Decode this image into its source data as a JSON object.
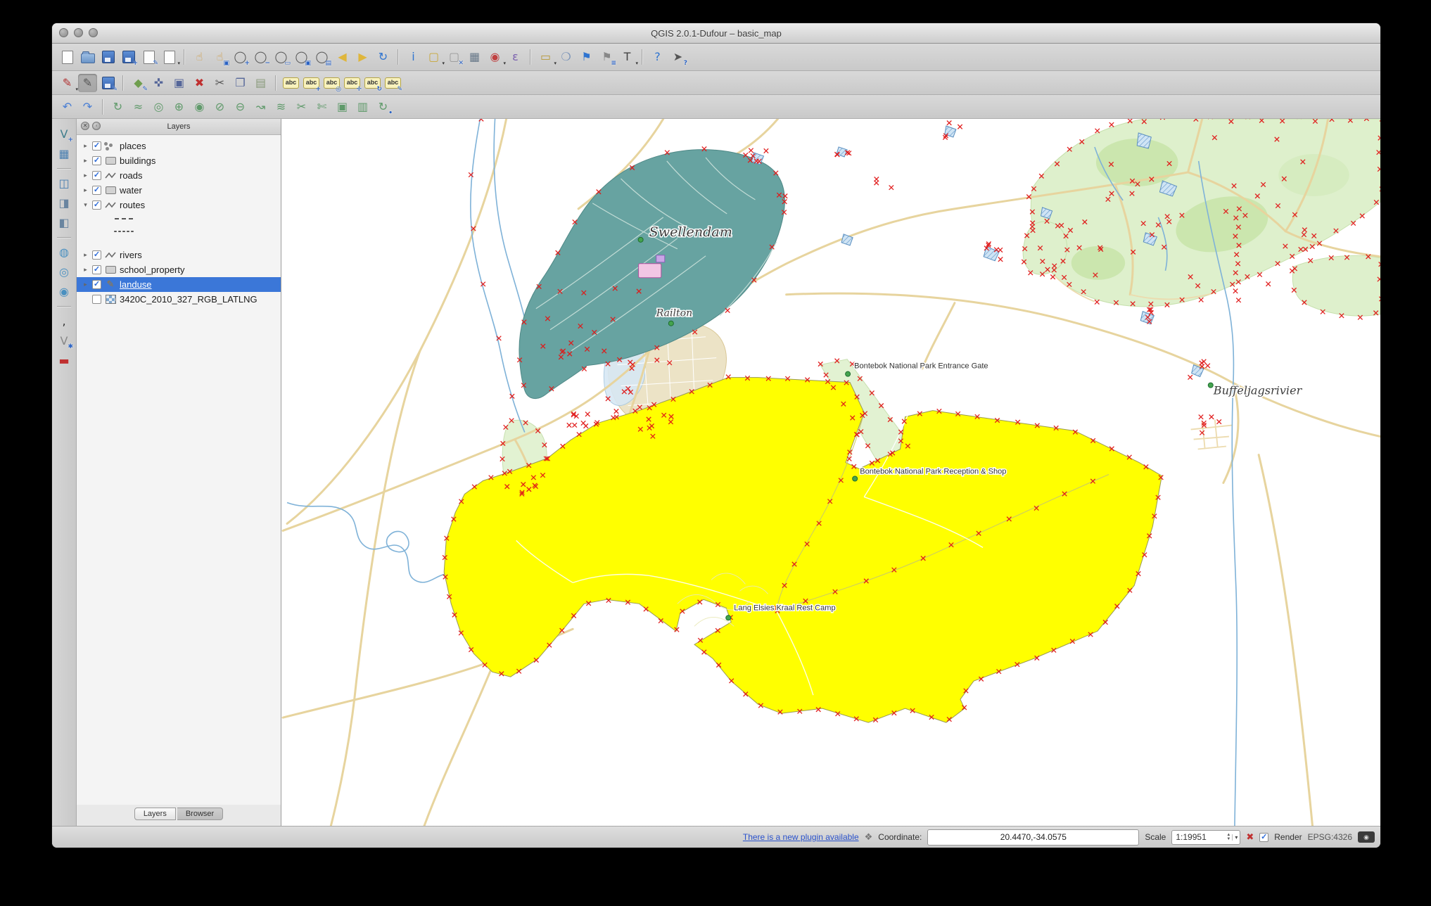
{
  "window_title": "QGIS 2.0.1-Dufour – basic_map",
  "toolbars": {
    "main": [
      {
        "n": "new-project",
        "shape": "page"
      },
      {
        "n": "open-project",
        "shape": "folder"
      },
      {
        "n": "save-project",
        "shape": "disk"
      },
      {
        "n": "save-project-as",
        "shape": "disk",
        "b": "+"
      },
      {
        "n": "new-print-composer",
        "shape": "page",
        "b": "✎"
      },
      {
        "n": "composer-manager",
        "shape": "page",
        "d": true
      },
      {
        "sep": true
      },
      {
        "n": "pan-map",
        "g": "☝",
        "c": "#d09a3e"
      },
      {
        "n": "pan-map-to-selection",
        "g": "☝",
        "c": "#d09a3e",
        "b": "▣"
      },
      {
        "n": "zoom-in",
        "g": "◯",
        "c": "#555555",
        "b": "+"
      },
      {
        "n": "zoom-out",
        "g": "◯",
        "c": "#555555",
        "b": "−"
      },
      {
        "n": "zoom-full",
        "g": "◯",
        "c": "#555555",
        "b": "▭"
      },
      {
        "n": "zoom-to-selection",
        "g": "◯",
        "c": "#555555",
        "b": "▣"
      },
      {
        "n": "zoom-to-layer",
        "g": "◯",
        "c": "#555555",
        "b": "▤"
      },
      {
        "n": "zoom-last",
        "g": "◀",
        "c": "#dfb63c"
      },
      {
        "n": "zoom-next",
        "g": "▶",
        "c": "#dfb63c"
      },
      {
        "n": "refresh-map",
        "g": "↻",
        "c": "#2f74d0"
      },
      {
        "sep": true
      },
      {
        "n": "identify-features",
        "g": "i",
        "c": "#2f74d0"
      },
      {
        "n": "select-features",
        "g": "▢",
        "c": "#c8a83a",
        "d": true
      },
      {
        "n": "deselect-features",
        "g": "▢",
        "c": "#999999",
        "b": "✕"
      },
      {
        "n": "open-attribute-table",
        "g": "▦",
        "c": "#667788"
      },
      {
        "n": "run-feature-action",
        "g": "◉",
        "c": "#c04040",
        "d": true
      },
      {
        "n": "field-calculator",
        "g": "ε",
        "c": "#7a5fae"
      },
      {
        "sep": true
      },
      {
        "n": "measure",
        "g": "▭",
        "c": "#b89a3a",
        "d": true
      },
      {
        "n": "map-tips",
        "g": "❍",
        "c": "#7a93b8"
      },
      {
        "n": "new-bookmark",
        "g": "⚑",
        "c": "#2f74d0"
      },
      {
        "n": "show-bookmarks",
        "g": "⚑",
        "c": "#888888",
        "b": "≡"
      },
      {
        "n": "text-annotation",
        "g": "T",
        "c": "#444444",
        "d": true
      },
      {
        "sep": true
      },
      {
        "n": "help-contents",
        "g": "?",
        "c": "#2f74d0"
      },
      {
        "n": "whats-this",
        "g": "➤",
        "c": "#555555",
        "b": "?"
      }
    ],
    "digitizing": [
      {
        "n": "current-edits",
        "g": "✎",
        "c": "#b03030",
        "d": true
      },
      {
        "n": "toggle-editing",
        "g": "✎",
        "c": "#555555",
        "a": true
      },
      {
        "n": "save-layer-edits",
        "shape": "disk",
        "b": "✎"
      },
      {
        "sep": true
      },
      {
        "n": "add-feature",
        "g": "◆",
        "c": "#6f9e4e",
        "b": "✎"
      },
      {
        "n": "move-feature",
        "g": "✜",
        "c": "#556699"
      },
      {
        "n": "node-tool",
        "g": "▣",
        "c": "#556699"
      },
      {
        "n": "delete-selected",
        "g": "✖",
        "c": "#c03030"
      },
      {
        "n": "cut-features",
        "g": "✂",
        "c": "#555555"
      },
      {
        "n": "copy-features",
        "g": "❐",
        "c": "#556699"
      },
      {
        "n": "paste-features",
        "g": "▤",
        "c": "#88997a"
      },
      {
        "sep": true
      },
      {
        "n": "labeling",
        "shape": "abc",
        "g": "abc"
      },
      {
        "n": "label-pin",
        "shape": "abc",
        "g": "abc",
        "b": "+"
      },
      {
        "n": "label-show-hidden",
        "shape": "abc",
        "g": "abc",
        "b": "◎"
      },
      {
        "n": "label-move",
        "shape": "abc",
        "g": "abc",
        "b": "✛"
      },
      {
        "n": "label-rotate",
        "shape": "abc",
        "g": "abc",
        "b": "↻"
      },
      {
        "n": "label-properties",
        "shape": "abc",
        "g": "abc",
        "b": "✎"
      }
    ],
    "advanced": [
      {
        "n": "undo",
        "g": "↶",
        "c": "#4a7fd4"
      },
      {
        "n": "redo",
        "g": "↷",
        "c": "#4a7fd4"
      },
      {
        "sep": true
      },
      {
        "n": "rotate-feature",
        "g": "↻",
        "c": "#5f9a6a"
      },
      {
        "n": "simplify-feature",
        "g": "≈",
        "c": "#5f9a6a"
      },
      {
        "n": "add-ring",
        "g": "◎",
        "c": "#5f9a6a"
      },
      {
        "n": "add-part",
        "g": "⊕",
        "c": "#5f9a6a"
      },
      {
        "n": "fill-ring",
        "g": "◉",
        "c": "#5f9a6a"
      },
      {
        "n": "delete-ring",
        "g": "⊘",
        "c": "#5f9a6a"
      },
      {
        "n": "delete-part",
        "g": "⊖",
        "c": "#5f9a6a"
      },
      {
        "n": "reshape-features",
        "g": "↝",
        "c": "#5f9a6a"
      },
      {
        "n": "offset-curve",
        "g": "≋",
        "c": "#5f9a6a"
      },
      {
        "n": "split-features",
        "g": "✂",
        "c": "#5f9a6a"
      },
      {
        "n": "split-parts",
        "g": "✄",
        "c": "#5f9a6a"
      },
      {
        "n": "merge-features",
        "g": "▣",
        "c": "#5f9a6a"
      },
      {
        "n": "merge-attributes",
        "g": "▥",
        "c": "#5f9a6a"
      },
      {
        "n": "rotate-point-symbols",
        "g": "↻",
        "c": "#5f9a6a",
        "b": "•"
      }
    ],
    "dock": [
      {
        "n": "add-vector-layer",
        "g": "V",
        "c": "#3f7d8c",
        "b": "+"
      },
      {
        "n": "add-raster-layer",
        "g": "▦",
        "c": "#4a7fb0"
      },
      {
        "sep": true
      },
      {
        "n": "add-postgis-layer",
        "g": "◫",
        "c": "#4a7fb0"
      },
      {
        "n": "add-spatialite-layer",
        "g": "◨",
        "c": "#6a85a0"
      },
      {
        "n": "add-mssql-layer",
        "g": "◧",
        "c": "#6a85a0"
      },
      {
        "sep": true
      },
      {
        "n": "add-wms-layer",
        "g": "◍",
        "c": "#4a90c0"
      },
      {
        "n": "add-wcs-layer",
        "g": "◎",
        "c": "#4a90c0"
      },
      {
        "n": "add-wfs-layer",
        "g": "◉",
        "c": "#4a90c0"
      },
      {
        "sep": true
      },
      {
        "n": "add-delimited-text-layer",
        "g": ",",
        "c": "#333333"
      },
      {
        "n": "new-shapefile-layer",
        "g": "V",
        "c": "#888888",
        "b": "✱"
      },
      {
        "n": "remove-layer",
        "g": "▬",
        "c": "#c03030"
      }
    ]
  },
  "layers_panel": {
    "title": "Layers",
    "layers": [
      {
        "label": "places",
        "checked": true,
        "geom": "point",
        "expander": "collapsed"
      },
      {
        "label": "buildings",
        "checked": true,
        "geom": "polygon",
        "expander": "collapsed"
      },
      {
        "label": "roads",
        "checked": true,
        "geom": "line",
        "expander": "collapsed"
      },
      {
        "label": "water",
        "checked": true,
        "geom": "polygon",
        "expander": "collapsed"
      },
      {
        "label": "routes",
        "checked": true,
        "geom": "line",
        "expander": "expanded",
        "children": [
          "dash",
          "dot"
        ]
      },
      {
        "label": "rivers",
        "checked": true,
        "geom": "line",
        "expander": "collapsed",
        "gap_before": true
      },
      {
        "label": "school_property",
        "checked": true,
        "geom": "polygon",
        "expander": "collapsed"
      },
      {
        "label": "landuse",
        "checked": true,
        "geom": "editing",
        "expander": "collapsed",
        "selected": true
      },
      {
        "label": "3420C_2010_327_RGB_LATLNG",
        "checked": false,
        "geom": "raster",
        "expander": "none"
      }
    ],
    "tabs": [
      {
        "label": "Layers",
        "active": true
      },
      {
        "label": "Browser",
        "active": false
      }
    ]
  },
  "map_labels": {
    "town": "Swellendam",
    "suburb": "Railton",
    "gate": "Bontebok National Park Entrance Gate",
    "reception": "Bontebok National Park Reception & Shop",
    "rest_camp": "Lang Elsies Kraal Rest Camp",
    "river": "Buffeljagsrivier"
  },
  "status_bar": {
    "plugin_link": "There is a new plugin available",
    "coordinate_label": "Coordinate:",
    "coordinate_value": "20.4470,-34.0575",
    "scale_label": "Scale",
    "scale_value": "1:19951",
    "render_label": "Render",
    "crs_label": "EPSG:4326"
  },
  "colors": {
    "selection_blue": "#3b77d8",
    "landuse_selected_fill": "#ffff00",
    "vertex_marker_red": "#e01818",
    "park_green": "#def0cc",
    "town_teal": "#67a3a1",
    "road_tan": "#e7d49e",
    "river_blue": "#7fb2d8"
  }
}
